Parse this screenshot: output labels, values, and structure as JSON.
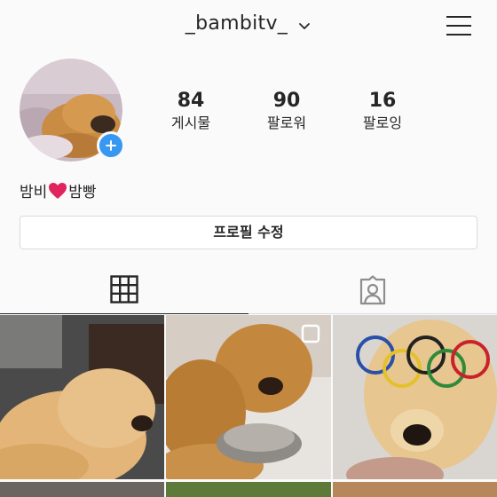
{
  "profile": {
    "username": "_bambitv_",
    "bio_part1": "밤비",
    "bio_part2": "밤빵",
    "edit_button_label": "프로필 수정"
  },
  "stats": [
    {
      "value": "84",
      "label": "게시물"
    },
    {
      "value": "90",
      "label": "팔로워"
    },
    {
      "value": "16",
      "label": "팔로잉"
    }
  ],
  "tabs": [
    "grid-icon",
    "tagged-icon"
  ],
  "colors": {
    "accent": "#3897f0",
    "heart": "#e0245e",
    "text": "#262626",
    "border": "#dbdbdb",
    "background": "#fafafa"
  }
}
